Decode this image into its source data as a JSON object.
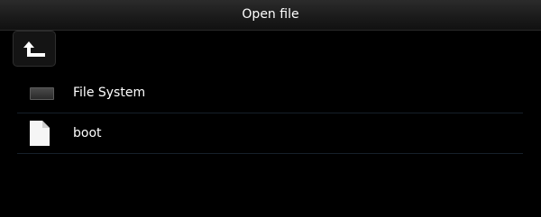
{
  "dialog": {
    "title": "Open file",
    "up_icon": "up-arrow-icon"
  },
  "files": [
    {
      "label": "File System",
      "icon": "drive-icon"
    },
    {
      "label": "boot",
      "icon": "file-icon"
    }
  ]
}
